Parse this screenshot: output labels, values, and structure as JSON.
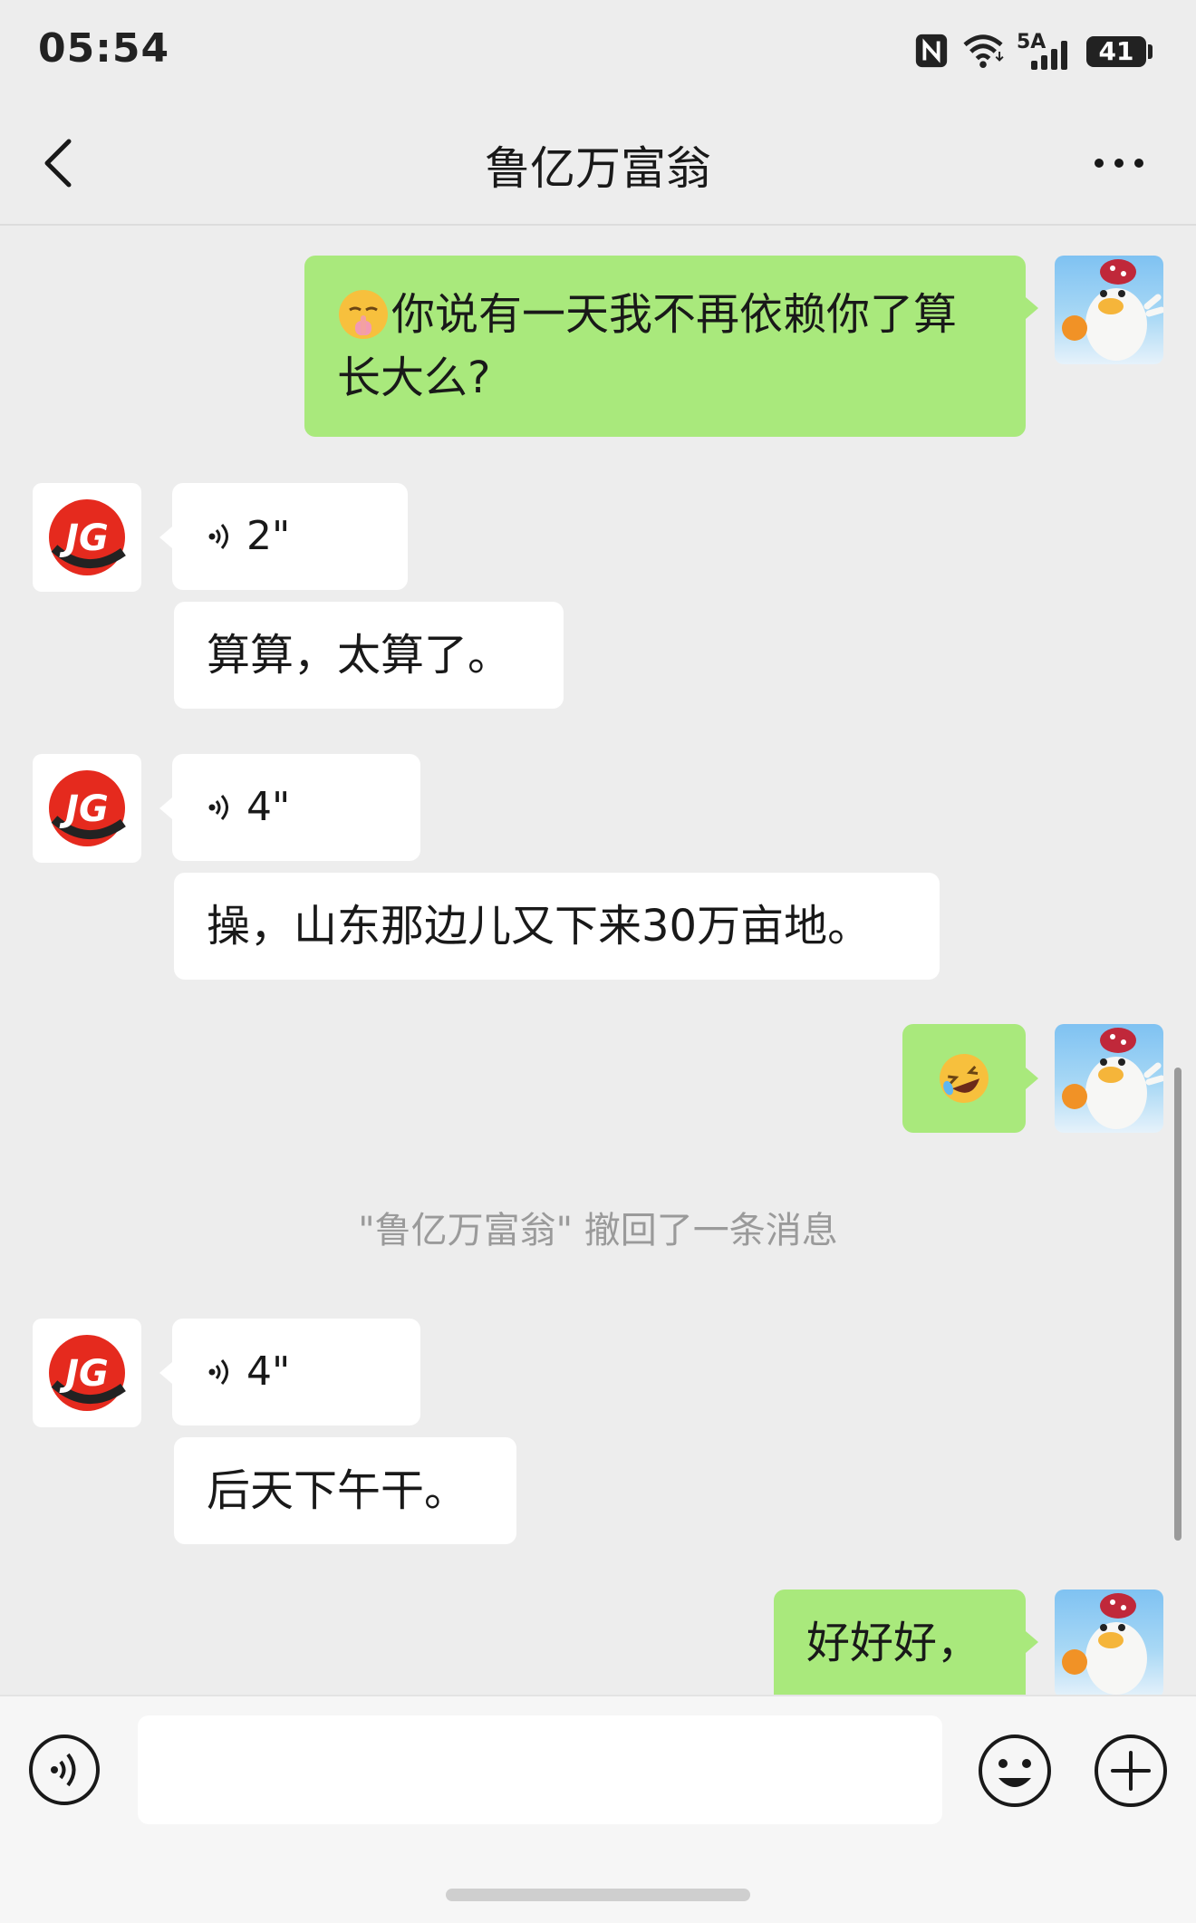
{
  "status_bar": {
    "time": "05:54",
    "network_label": "5A",
    "battery_level": "41"
  },
  "header": {
    "title": "鲁亿万富翁"
  },
  "messages": [
    {
      "side": "me",
      "text": "你说有一天我不再依赖你了算长大么?",
      "line1": "你说有一天我不再依赖你了算",
      "line2": "长大么?",
      "emoji": "shushing-face"
    },
    {
      "side": "them",
      "voice_duration": "2\"",
      "transcription": "算算，太算了。"
    },
    {
      "side": "them",
      "voice_duration": "4\"",
      "transcription": "操，山东那边儿又下来30万亩地。"
    },
    {
      "side": "me",
      "emoji": "rolling-on-floor-laughing"
    },
    {
      "side": "them",
      "voice_duration": "4\"",
      "transcription": "后天下午干。"
    },
    {
      "side": "me",
      "text": "好好好，"
    }
  ],
  "system_note": "\"鲁亿万富翁\" 撤回了一条消息",
  "input_bar": {
    "placeholder": ""
  },
  "colors": {
    "background": "#ededed",
    "my_bubble": "#a9e97c",
    "their_bubble": "#ffffff",
    "accent": "#e52a1e"
  }
}
